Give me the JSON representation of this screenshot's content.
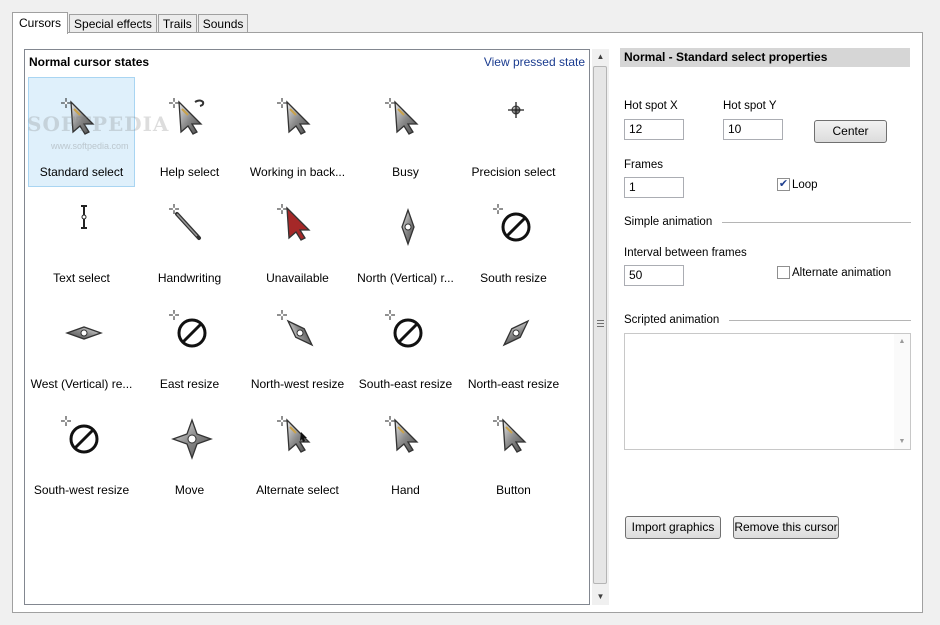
{
  "tabs": [
    "Cursors",
    "Special effects",
    "Trails",
    "Sounds"
  ],
  "list": {
    "title": "Normal cursor states",
    "view_link": "View pressed state",
    "items": [
      {
        "label": "Standard select",
        "icon": "arrow-cursor-icon"
      },
      {
        "label": "Help select",
        "icon": "help-cursor-icon"
      },
      {
        "label": "Working in back...",
        "icon": "working-cursor-icon"
      },
      {
        "label": "Busy",
        "icon": "busy-cursor-icon"
      },
      {
        "label": "Precision select",
        "icon": "crosshair-cursor-icon"
      },
      {
        "label": "Text select",
        "icon": "text-cursor-icon"
      },
      {
        "label": "Handwriting",
        "icon": "pen-cursor-icon"
      },
      {
        "label": "Unavailable",
        "icon": "unavailable-cursor-icon"
      },
      {
        "label": "North (Vertical) r...",
        "icon": "vertical-resize-icon"
      },
      {
        "label": "South resize",
        "icon": "south-resize-icon"
      },
      {
        "label": "West (Vertical) re...",
        "icon": "horizontal-resize-icon"
      },
      {
        "label": "East resize",
        "icon": "east-resize-icon"
      },
      {
        "label": "North-west resize",
        "icon": "nw-resize-icon"
      },
      {
        "label": "South-east resize",
        "icon": "se-resize-icon"
      },
      {
        "label": "North-east resize",
        "icon": "ne-resize-icon"
      },
      {
        "label": "South-west resize",
        "icon": "sw-resize-icon"
      },
      {
        "label": "Move",
        "icon": "move-cursor-icon"
      },
      {
        "label": "Alternate select",
        "icon": "alternate-cursor-icon"
      },
      {
        "label": "Hand",
        "icon": "hand-cursor-icon"
      },
      {
        "label": "Button",
        "icon": "button-cursor-icon"
      }
    ],
    "watermark": "SOFTPEDIA",
    "watermark_url": "www.softpedia.com"
  },
  "props": {
    "header": "Normal - Standard select properties",
    "hotspot_x_label": "Hot spot X",
    "hotspot_x_value": "12",
    "hotspot_y_label": "Hot spot Y",
    "hotspot_y_value": "10",
    "center_button": "Center",
    "frames_label": "Frames",
    "frames_value": "1",
    "loop_label": "Loop",
    "loop_checked": true,
    "simple_animation": "Simple animation",
    "interval_label": "Interval between frames",
    "interval_value": "50",
    "alternate_label": "Alternate animation",
    "alternate_checked": false,
    "scripted_animation": "Scripted animation",
    "import_button": "Import graphics",
    "remove_button": "Remove this cursor"
  },
  "colors": {
    "selected_bg": "#dff0fb",
    "link": "#1a3b8f",
    "header_bg": "#d6d6d6"
  }
}
